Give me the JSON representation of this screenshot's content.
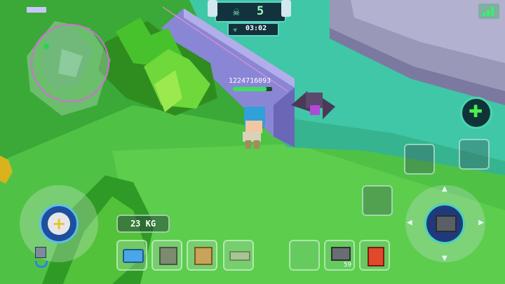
{
  "hud": {
    "kills": "5",
    "timer": "03:02"
  },
  "player": {
    "name": "1224716093",
    "health_percent": 85
  },
  "inventory": {
    "weight": "23 KG",
    "item_count": "59"
  },
  "signal": {
    "bars": 3
  },
  "colors": {
    "grass": "#3fae3b",
    "ground_light": "#55c94a",
    "wall": "#8f8ad8",
    "water": "#3fc7a7",
    "gray_building": "#9a98b8",
    "hud_accent": "#5fd3c2",
    "health_green": "#3ee05a"
  },
  "icons": {
    "kills": "skull-icon",
    "timer": "biohazard-icon",
    "signal": "signal-bars-icon",
    "skill": "green-star-skill-icon",
    "joystick": "crosshair-plus-icon",
    "fire": "blaster-gun-icon",
    "slot1": "blue-boots-icon",
    "slot2": "stone-block-icon",
    "slot3": "wooden-block-icon",
    "slot4": "flat-plank-icon",
    "item_gun": "blaster-gun-icon",
    "item_red": "red-flag-block-icon"
  }
}
